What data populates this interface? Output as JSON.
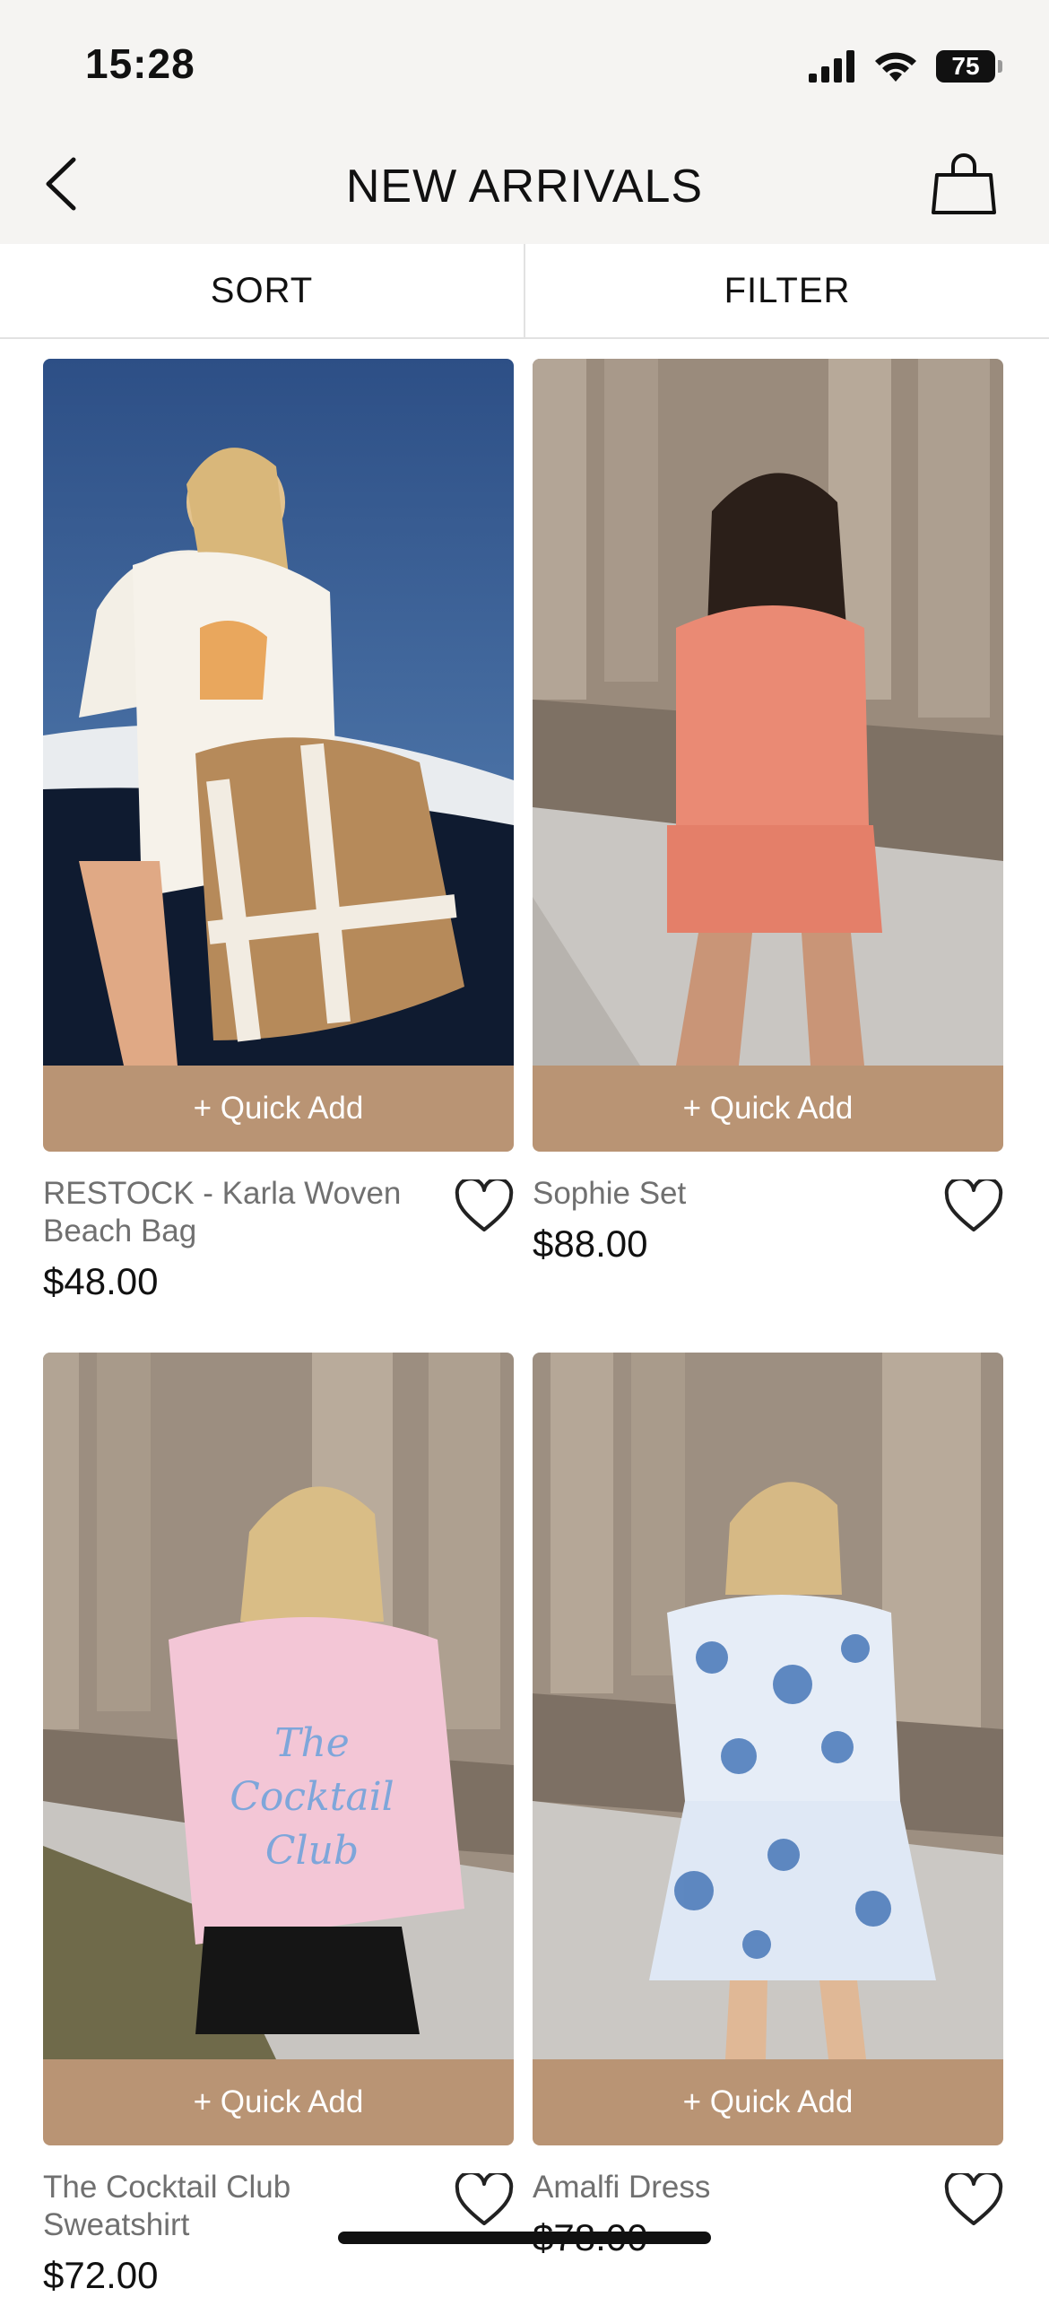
{
  "status_bar": {
    "time": "15:28",
    "battery": "75"
  },
  "header": {
    "title": "NEW ARRIVALS"
  },
  "sort_filter": {
    "sort_label": "SORT",
    "filter_label": "FILTER"
  },
  "products": [
    {
      "name": "RESTOCK - Karla Woven Beach Bag",
      "price": "$48.00",
      "quick_add": "+ Quick Add"
    },
    {
      "name": "Sophie Set",
      "price": "$88.00",
      "quick_add": "+ Quick Add"
    },
    {
      "name": "The Cocktail Club Sweatshirt",
      "price": "$72.00",
      "quick_add": "+ Quick Add"
    },
    {
      "name": "Amalfi Dress",
      "price": "$78.00",
      "quick_add": "+ Quick Add"
    }
  ],
  "colors": {
    "accent": "#b99474",
    "nav_bg": "#f5f4f2"
  }
}
